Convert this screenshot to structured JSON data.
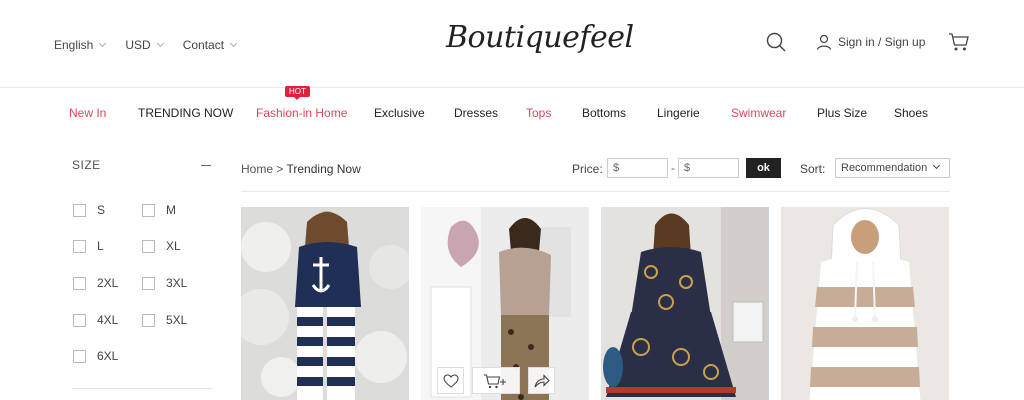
{
  "header": {
    "language": "English",
    "currency": "USD",
    "contact": "Contact",
    "logo": "Boutiquefeel",
    "signin": "Sign in / Sign up"
  },
  "nav": {
    "badge": "HOT",
    "items": [
      "New In",
      "TRENDING NOW",
      "Fashion-in Home",
      "Exclusive",
      "Dresses",
      "Tops",
      "Bottoms",
      "Lingerie",
      "Swimwear",
      "Plus Size",
      "Shoes"
    ]
  },
  "sidebar": {
    "title": "SIZE",
    "sizes": [
      "S",
      "M",
      "L",
      "XL",
      "2XL",
      "3XL",
      "4XL",
      "5XL",
      "6XL"
    ]
  },
  "filter": {
    "breadcrumb_home": "Home",
    "breadcrumb_sep": ">",
    "breadcrumb_current": "Trending Now",
    "price_label": "Price:",
    "price_min_placeholder": "$",
    "price_max_placeholder": "$",
    "price_sep": "-",
    "ok_label": "ok",
    "sort_label": "Sort:",
    "sort_value": "Recommendation"
  },
  "colors": {
    "accent_red": "#d9485f",
    "hot_badge": "#e0223f",
    "dark": "#222222"
  },
  "products": [
    {
      "image": "woman-navy-anchor-top-striped-pants"
    },
    {
      "image": "woman-beige-top-leopard-pants"
    },
    {
      "image": "woman-navy-chain-print-dress"
    },
    {
      "image": "woman-beige-striped-hoodie"
    }
  ]
}
